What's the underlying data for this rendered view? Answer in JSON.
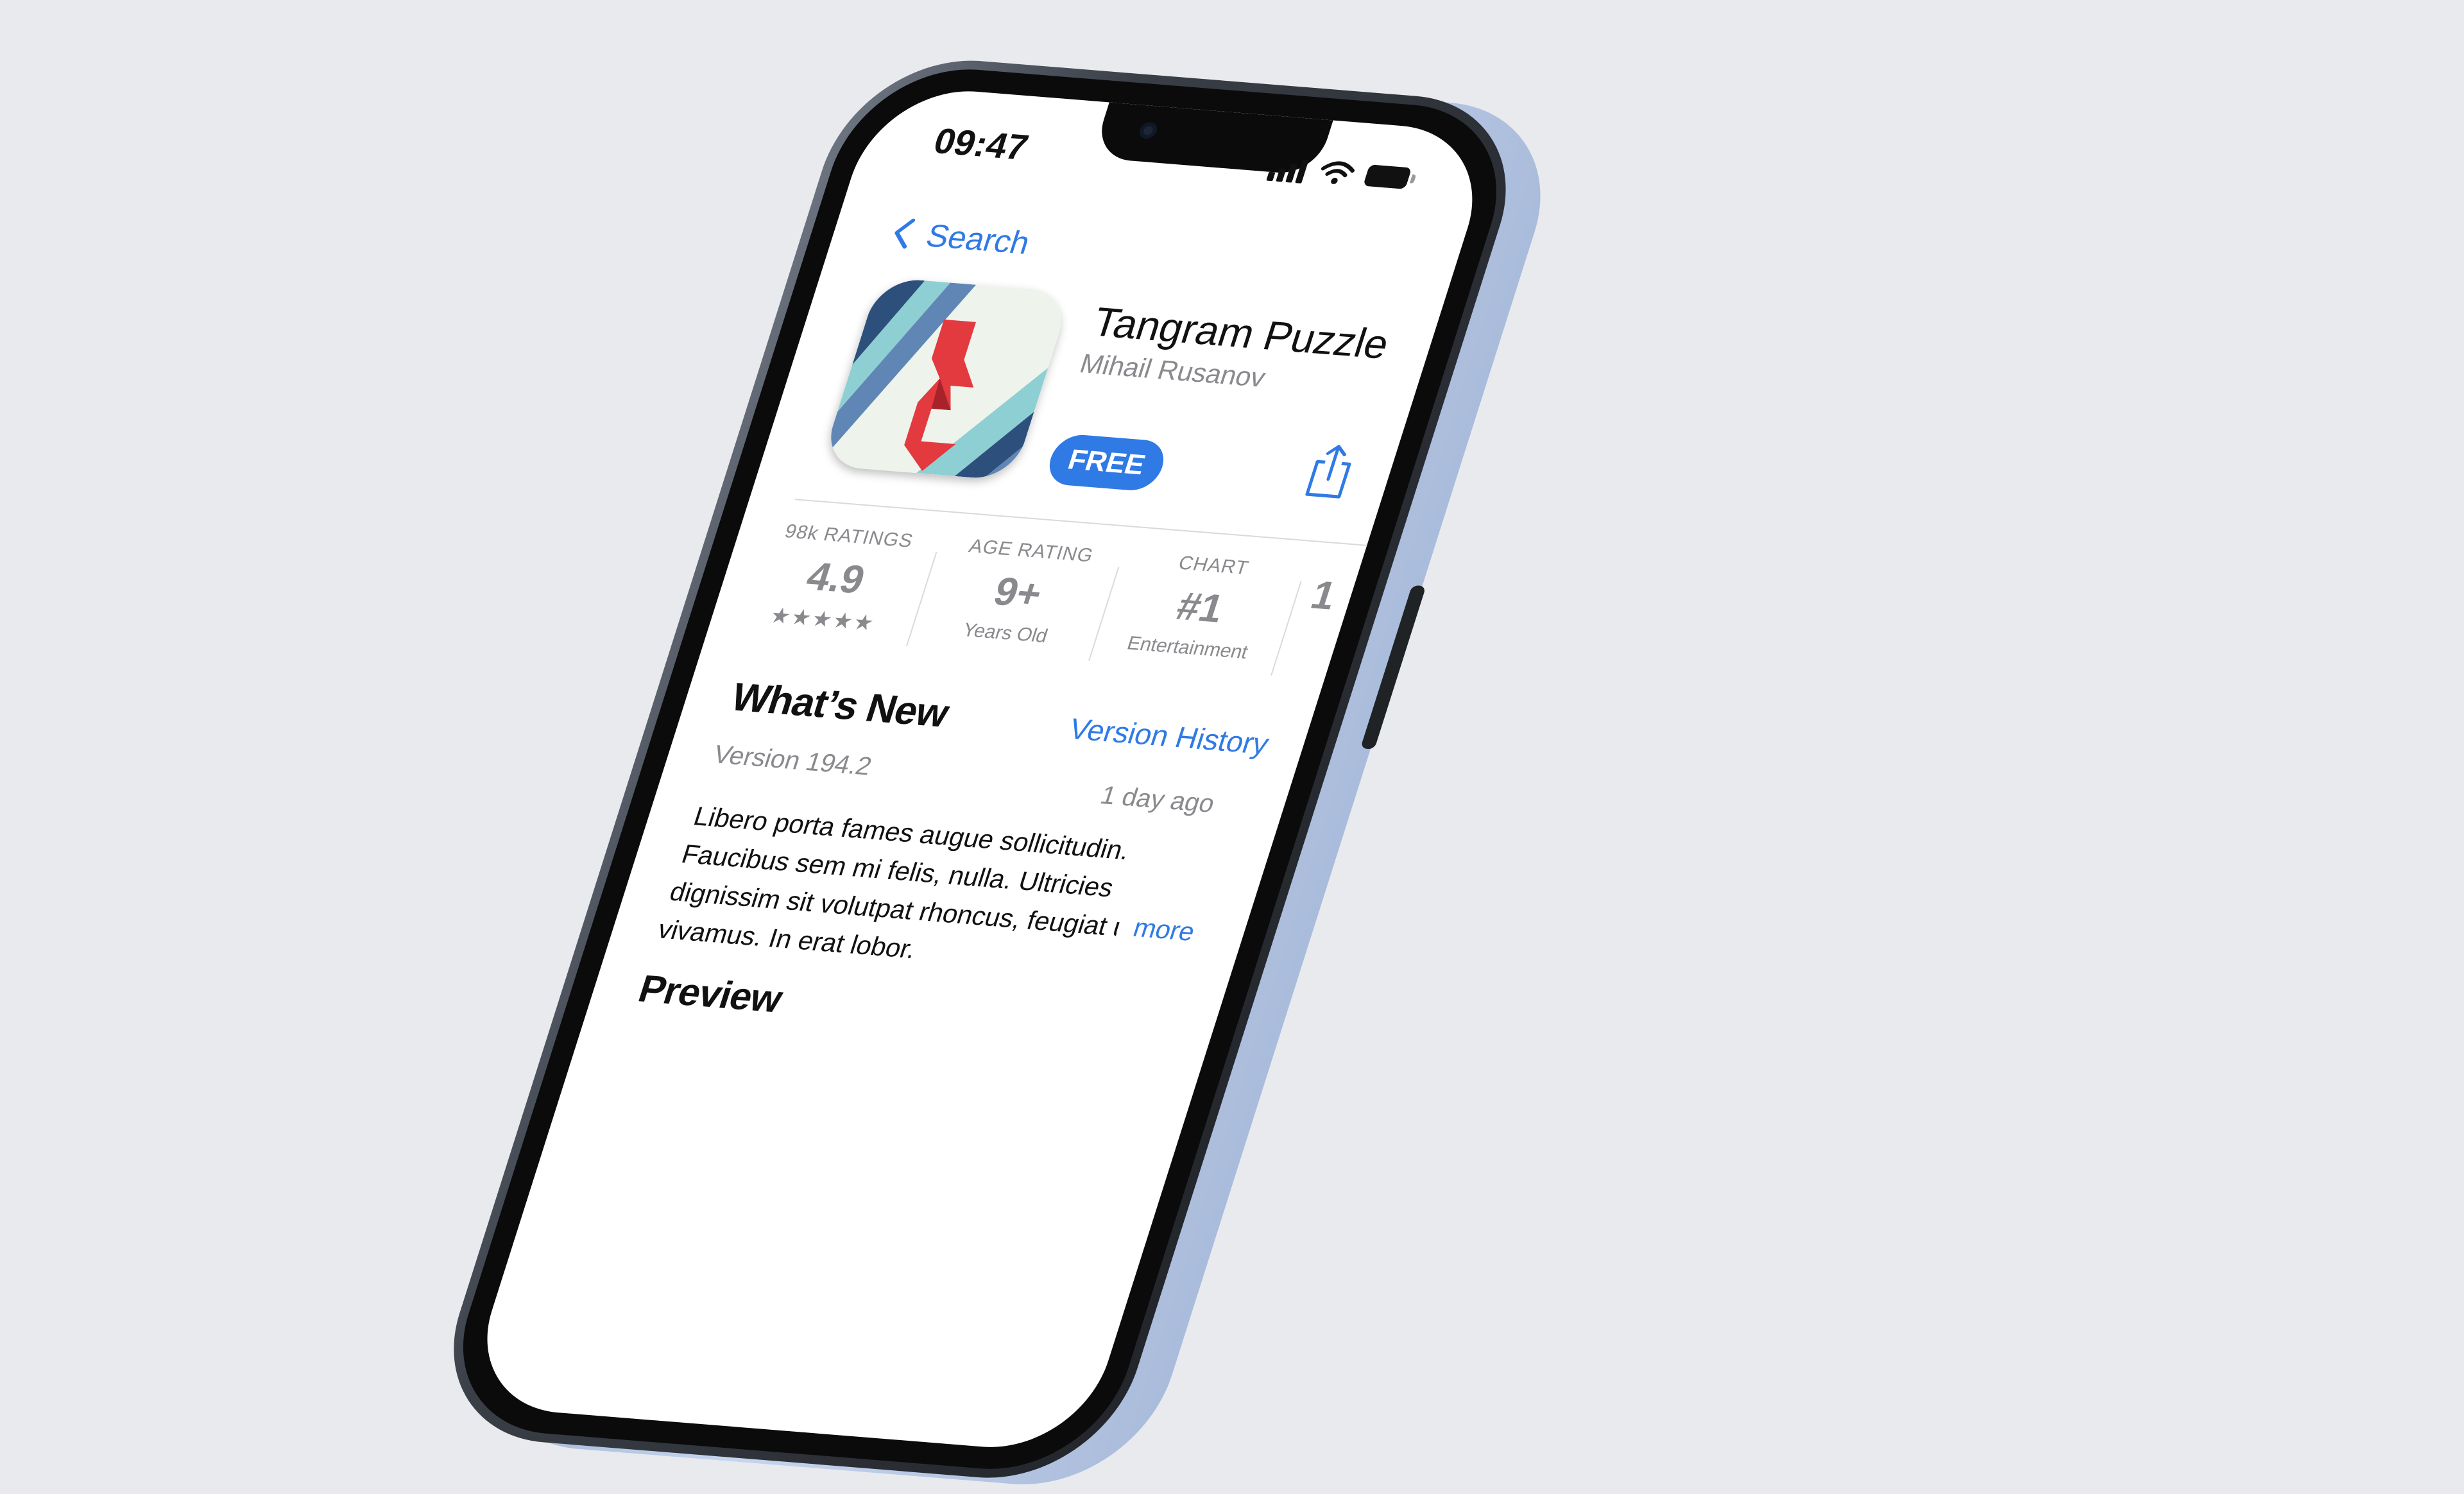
{
  "status_bar": {
    "time": "09:47"
  },
  "nav": {
    "back_label": "Search"
  },
  "app": {
    "title": "Tangram Puzzle",
    "developer": "Mihail Rusanov",
    "get_label": "FREE"
  },
  "stats": [
    {
      "top": "98k RATINGS",
      "main": "4.9",
      "sub": "★★★★★"
    },
    {
      "top": "AGE RATING",
      "main": "9+",
      "sub": "Years Old"
    },
    {
      "top": "CHART",
      "main": "#1",
      "sub": "Entertainment"
    },
    {
      "top": "",
      "main": "1",
      "sub": ""
    }
  ],
  "whats_new": {
    "title": "What’s New",
    "history_link": "Version History",
    "version": "Version 194.2",
    "date": "1 day ago",
    "notes": "Libero porta fames augue sollicitudin. Faucibus sem mi felis, nulla. Ultricies dignissim sit volutpat rhoncus, feugiat urna vivamus. In erat lobor.",
    "more_label": "more"
  },
  "preview": {
    "title": "Preview"
  },
  "colors": {
    "accent": "#2f7ae5",
    "background": "#e9eaee",
    "icon_red": "#e23a3f",
    "icon_navy": "#2d4f7c",
    "icon_teal": "#8ecfd4"
  },
  "icons": [
    "chevron-left-icon",
    "signal-icon",
    "wifi-icon",
    "battery-icon",
    "share-icon",
    "app-icon"
  ]
}
